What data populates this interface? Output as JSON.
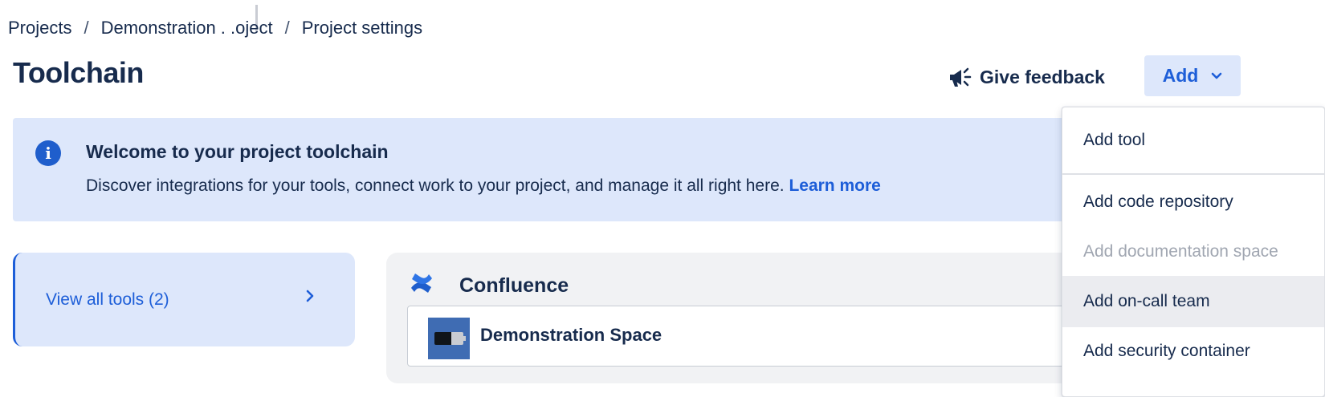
{
  "breadcrumb": {
    "items": [
      "Projects",
      "Demonstration . .oject",
      "Project settings"
    ],
    "separator": "/"
  },
  "page": {
    "title": "Toolchain"
  },
  "header": {
    "feedback_label": "Give feedback",
    "feedback_icon": "megaphone-icon",
    "add_label": "Add",
    "add_icon": "chevron-down-icon"
  },
  "banner": {
    "icon": "info-icon",
    "title": "Welcome to your project toolchain",
    "text": "Discover integrations for your tools, connect work to your project, and manage it all right here.",
    "link": "Learn more"
  },
  "sidebar": {
    "view_all_label": "View all tools (2)",
    "arrow_icon": "chevron-right-icon"
  },
  "confluence": {
    "title": "Confluence",
    "logo_icon": "confluence-logo-icon",
    "spaces": [
      {
        "name": "Demonstration Space"
      }
    ]
  },
  "dropdown": {
    "items": [
      {
        "label": "Add tool",
        "state": "enabled"
      },
      {
        "label": "Add code repository",
        "state": "enabled"
      },
      {
        "label": "Add documentation space",
        "state": "disabled"
      },
      {
        "label": "Add on-call team",
        "state": "hovered"
      },
      {
        "label": "Add security container",
        "state": "enabled"
      }
    ]
  },
  "colors": {
    "accent": "#1d5ed8",
    "banner_bg": "#dde7fb",
    "text": "#172b4d",
    "disabled_text": "#a0a6b1",
    "card_bg": "#f1f2f4"
  }
}
